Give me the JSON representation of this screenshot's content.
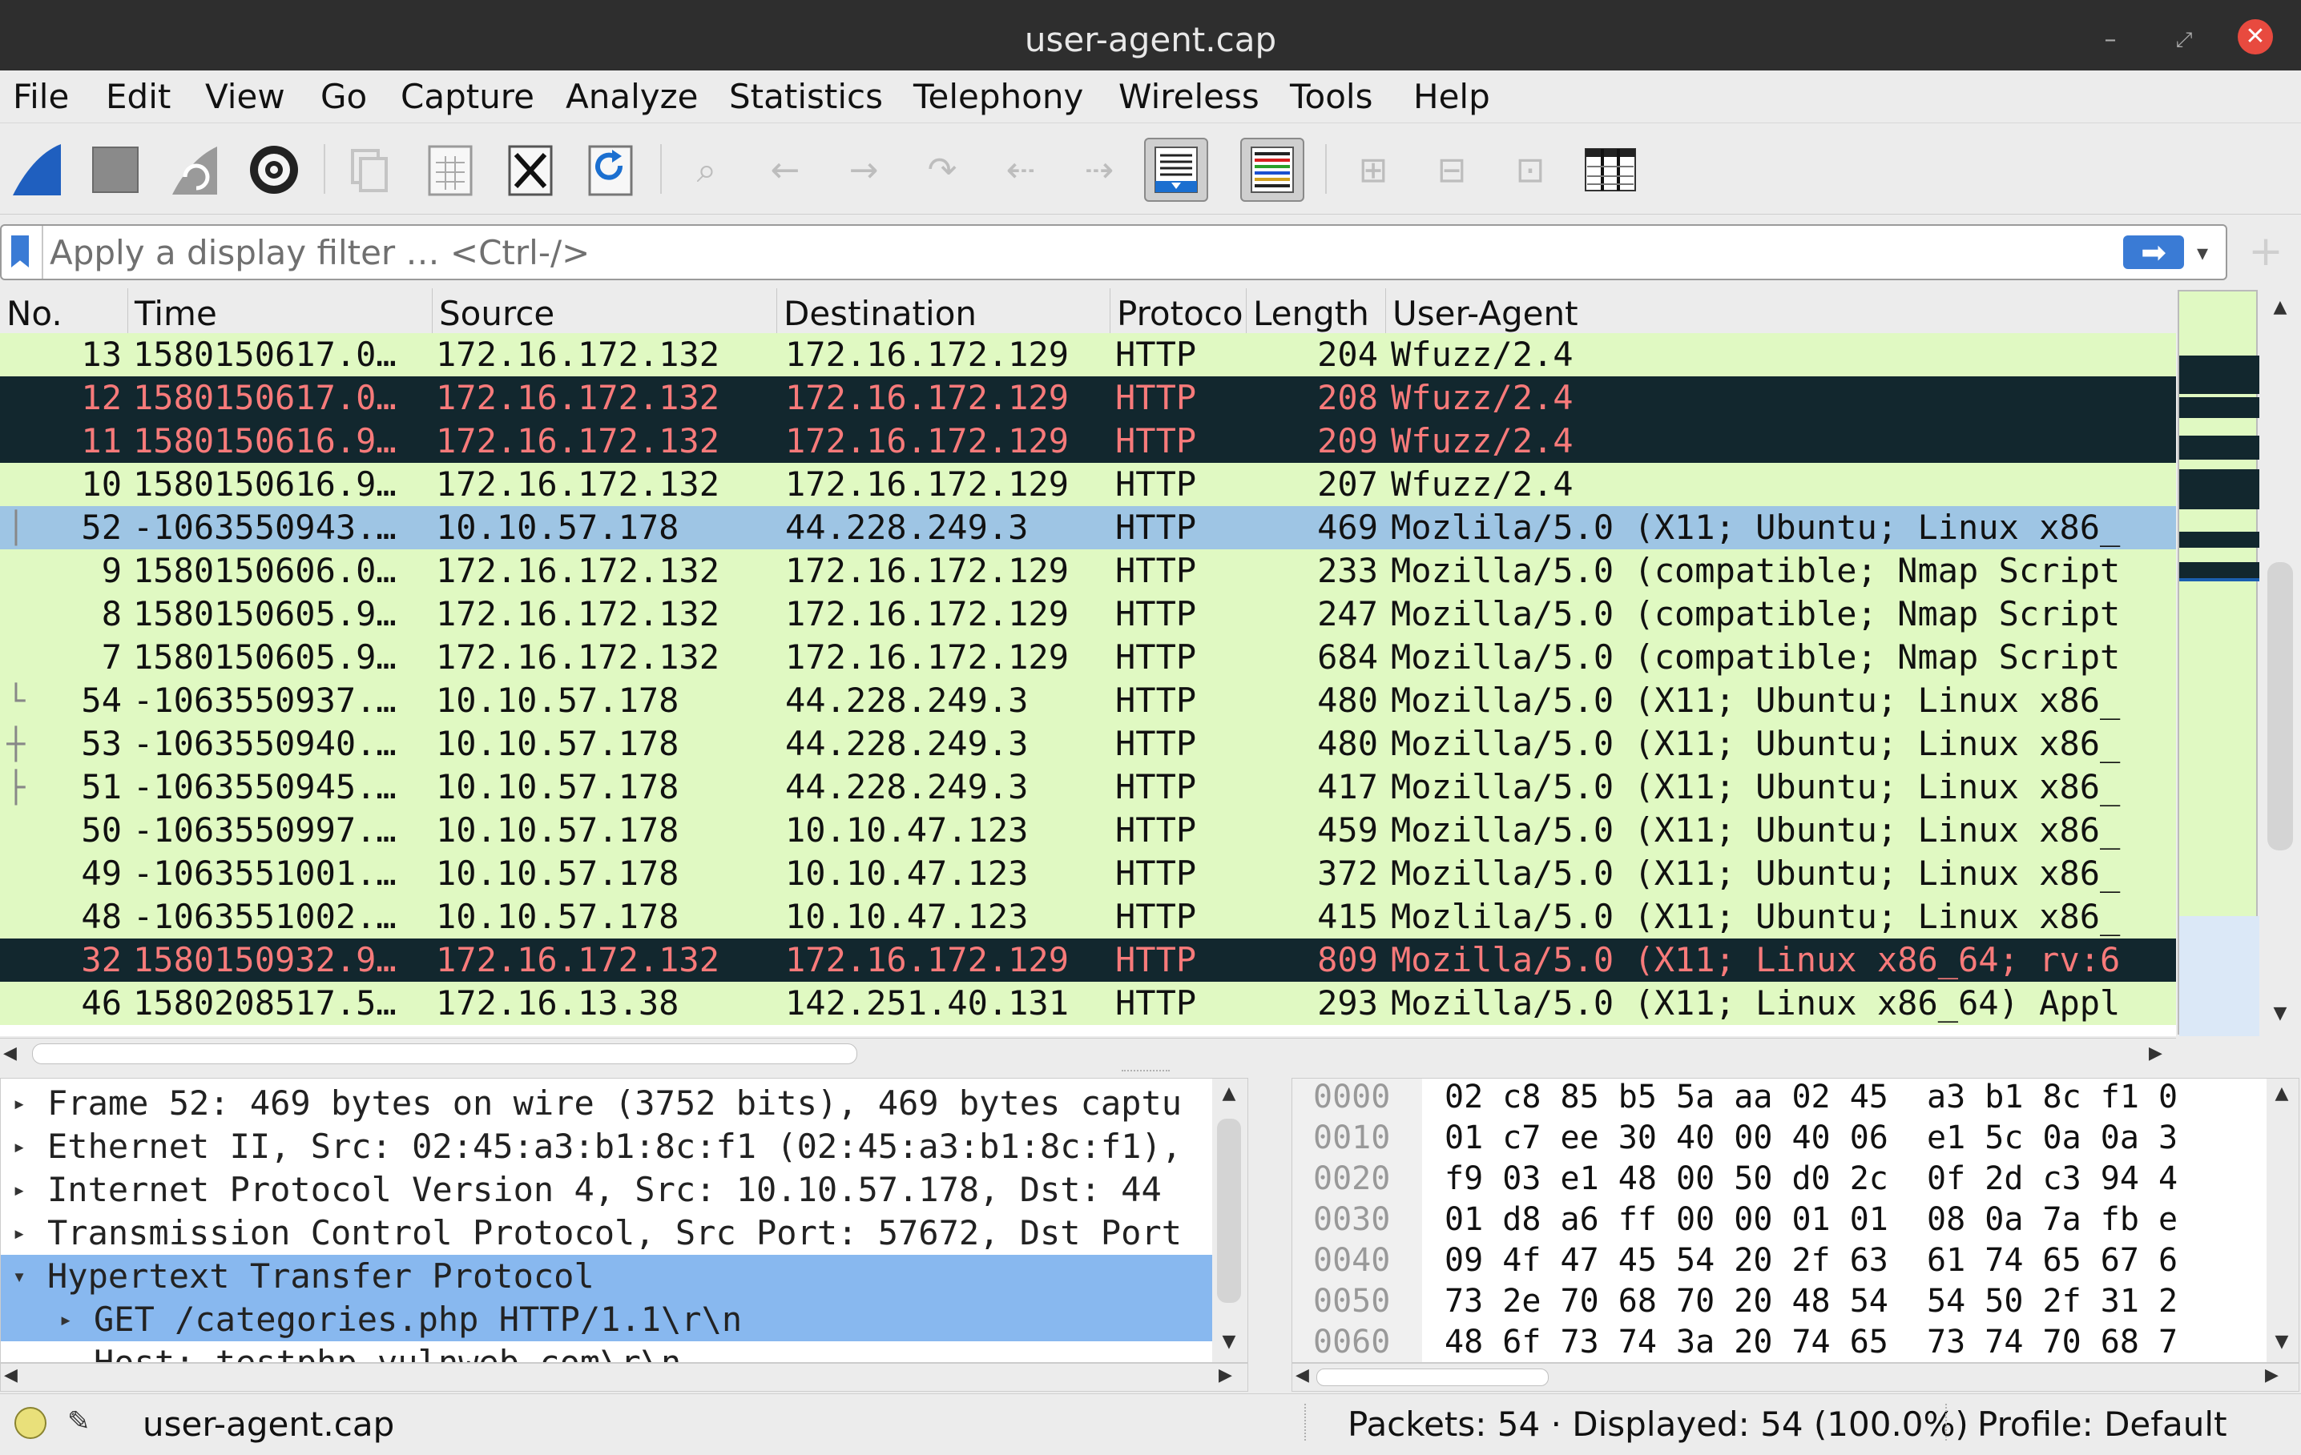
{
  "window": {
    "title": "user-agent.cap"
  },
  "menu": [
    "File",
    "Edit",
    "View",
    "Go",
    "Capture",
    "Analyze",
    "Statistics",
    "Telephony",
    "Wireless",
    "Tools",
    "Help"
  ],
  "filter": {
    "placeholder": "Apply a display filter … <Ctrl-/>"
  },
  "packet_list": {
    "columns": [
      "No.",
      "Time",
      "Source",
      "Destination",
      "Protoco",
      "Length",
      "User-Agent"
    ],
    "rows": [
      {
        "no": "13",
        "time": "1580150617.0…",
        "src": "172.16.172.132",
        "dst": "172.16.172.129",
        "proto": "HTTP",
        "len": "204",
        "ua": "Wfuzz/2.4",
        "style": "green",
        "mark": ""
      },
      {
        "no": "12",
        "time": "1580150617.0…",
        "src": "172.16.172.132",
        "dst": "172.16.172.129",
        "proto": "HTTP",
        "len": "208",
        "ua": "Wfuzz/2.4",
        "style": "dark",
        "mark": ""
      },
      {
        "no": "11",
        "time": "1580150616.9…",
        "src": "172.16.172.132",
        "dst": "172.16.172.129",
        "proto": "HTTP",
        "len": "209",
        "ua": "Wfuzz/2.4",
        "style": "dark",
        "mark": ""
      },
      {
        "no": "10",
        "time": "1580150616.9…",
        "src": "172.16.172.132",
        "dst": "172.16.172.129",
        "proto": "HTTP",
        "len": "207",
        "ua": "Wfuzz/2.4",
        "style": "green",
        "mark": ""
      },
      {
        "no": "52",
        "time": "-1063550943.…",
        "src": "10.10.57.178",
        "dst": "44.228.249.3",
        "proto": "HTTP",
        "len": "469",
        "ua": "Mozlila/5.0 (X11; Ubuntu; Linux x86_",
        "style": "selected",
        "mark": "│"
      },
      {
        "no": "9",
        "time": "1580150606.0…",
        "src": "172.16.172.132",
        "dst": "172.16.172.129",
        "proto": "HTTP",
        "len": "233",
        "ua": "Mozilla/5.0 (compatible; Nmap Script",
        "style": "green",
        "mark": ""
      },
      {
        "no": "8",
        "time": "1580150605.9…",
        "src": "172.16.172.132",
        "dst": "172.16.172.129",
        "proto": "HTTP",
        "len": "247",
        "ua": "Mozilla/5.0 (compatible; Nmap Script",
        "style": "green",
        "mark": ""
      },
      {
        "no": "7",
        "time": "1580150605.9…",
        "src": "172.16.172.132",
        "dst": "172.16.172.129",
        "proto": "HTTP",
        "len": "684",
        "ua": "Mozilla/5.0 (compatible; Nmap Script",
        "style": "green",
        "mark": ""
      },
      {
        "no": "54",
        "time": "-1063550937.…",
        "src": "10.10.57.178",
        "dst": "44.228.249.3",
        "proto": "HTTP",
        "len": "480",
        "ua": "Mozilla/5.0 (X11; Ubuntu; Linux x86_",
        "style": "green",
        "mark": "└"
      },
      {
        "no": "53",
        "time": "-1063550940.…",
        "src": "10.10.57.178",
        "dst": "44.228.249.3",
        "proto": "HTTP",
        "len": "480",
        "ua": "Mozilla/5.0 (X11; Ubuntu; Linux x86_",
        "style": "green",
        "mark": "┼"
      },
      {
        "no": "51",
        "time": "-1063550945.…",
        "src": "10.10.57.178",
        "dst": "44.228.249.3",
        "proto": "HTTP",
        "len": "417",
        "ua": "Mozilla/5.0 (X11; Ubuntu; Linux x86_",
        "style": "green",
        "mark": "├"
      },
      {
        "no": "50",
        "time": "-1063550997.…",
        "src": "10.10.57.178",
        "dst": "10.10.47.123",
        "proto": "HTTP",
        "len": "459",
        "ua": "Mozilla/5.0 (X11; Ubuntu; Linux x86_",
        "style": "green",
        "mark": ""
      },
      {
        "no": "49",
        "time": "-1063551001.…",
        "src": "10.10.57.178",
        "dst": "10.10.47.123",
        "proto": "HTTP",
        "len": "372",
        "ua": "Mozilla/5.0 (X11; Ubuntu; Linux x86_",
        "style": "green",
        "mark": ""
      },
      {
        "no": "48",
        "time": "-1063551002.…",
        "src": "10.10.57.178",
        "dst": "10.10.47.123",
        "proto": "HTTP",
        "len": "415",
        "ua": "Mozlila/5.0 (X11; Ubuntu; Linux x86_",
        "style": "green",
        "mark": ""
      },
      {
        "no": "32",
        "time": "1580150932.9…",
        "src": "172.16.172.132",
        "dst": "172.16.172.129",
        "proto": "HTTP",
        "len": "809",
        "ua": "Mozilla/5.0 (X11; Linux x86_64; rv:6",
        "style": "dark",
        "mark": ""
      },
      {
        "no": "46",
        "time": "1580208517.5…",
        "src": "172.16.13.38",
        "dst": "142.251.40.131",
        "proto": "HTTP",
        "len": "293",
        "ua": "Mozilla/5.0 (X11; Linux x86_64) Appl",
        "style": "green",
        "mark": ""
      }
    ]
  },
  "details": [
    {
      "text": "Frame 52: 469 bytes on wire (3752 bits), 469 bytes captu",
      "expanded": false,
      "selected": false,
      "level": 0
    },
    {
      "text": "Ethernet II, Src: 02:45:a3:b1:8c:f1 (02:45:a3:b1:8c:f1),",
      "expanded": false,
      "selected": false,
      "level": 0
    },
    {
      "text": "Internet Protocol Version 4, Src: 10.10.57.178, Dst: 44",
      "expanded": false,
      "selected": false,
      "level": 0
    },
    {
      "text": "Transmission Control Protocol, Src Port: 57672, Dst Port",
      "expanded": false,
      "selected": false,
      "level": 0
    },
    {
      "text": "Hypertext Transfer Protocol",
      "expanded": true,
      "selected": true,
      "level": 0
    },
    {
      "text": "GET /categories.php HTTP/1.1\\r\\n",
      "expanded": false,
      "selected": true,
      "level": 1
    },
    {
      "text": "Host: testphp.vulnweb.com\\r\\n",
      "expanded": null,
      "selected": false,
      "level": 1
    }
  ],
  "hex": [
    {
      "offset": "0000",
      "bytes": "02 c8 85 b5 5a aa 02 45  a3 b1 8c f1 0"
    },
    {
      "offset": "0010",
      "bytes": "01 c7 ee 30 40 00 40 06  e1 5c 0a 0a 3"
    },
    {
      "offset": "0020",
      "bytes": "f9 03 e1 48 00 50 d0 2c  0f 2d c3 94 4"
    },
    {
      "offset": "0030",
      "bytes": "01 d8 a6 ff 00 00 01 01  08 0a 7a fb e"
    },
    {
      "offset": "0040",
      "bytes": "09 4f 47 45 54 20 2f 63  61 74 65 67 6"
    },
    {
      "offset": "0050",
      "bytes": "73 2e 70 68 70 20 48 54  54 50 2f 31 2"
    },
    {
      "offset": "0060",
      "bytes": "48 6f 73 74 3a 20 74 65  73 74 70 68 7"
    }
  ],
  "status": {
    "file": "user-agent.cap",
    "packets": "Packets: 54 · Displayed: 54 (100.0%)",
    "profile": "Profile: Default"
  },
  "colors": {
    "row_green": "#e0f9c2",
    "row_dark_bg": "#12272e",
    "row_dark_fg": "#f77a7a",
    "row_selected": "#9ec5e4",
    "detail_selected": "#88b8ef",
    "accent_blue": "#1b5fb0"
  },
  "icons": [
    "shark-fin-start-icon",
    "stop-square-icon",
    "restart-fin-icon",
    "capture-options-gear-icon",
    "open-file-icon",
    "save-file-icon",
    "close-file-icon",
    "reload-icon",
    "search-icon",
    "back-arrow-icon",
    "forward-arrow-icon",
    "go-to-packet-icon",
    "first-packet-icon",
    "last-packet-icon",
    "autoscroll-icon",
    "colorize-icon",
    "zoom-in-icon",
    "zoom-out-icon",
    "normal-size-icon",
    "resize-columns-icon"
  ]
}
